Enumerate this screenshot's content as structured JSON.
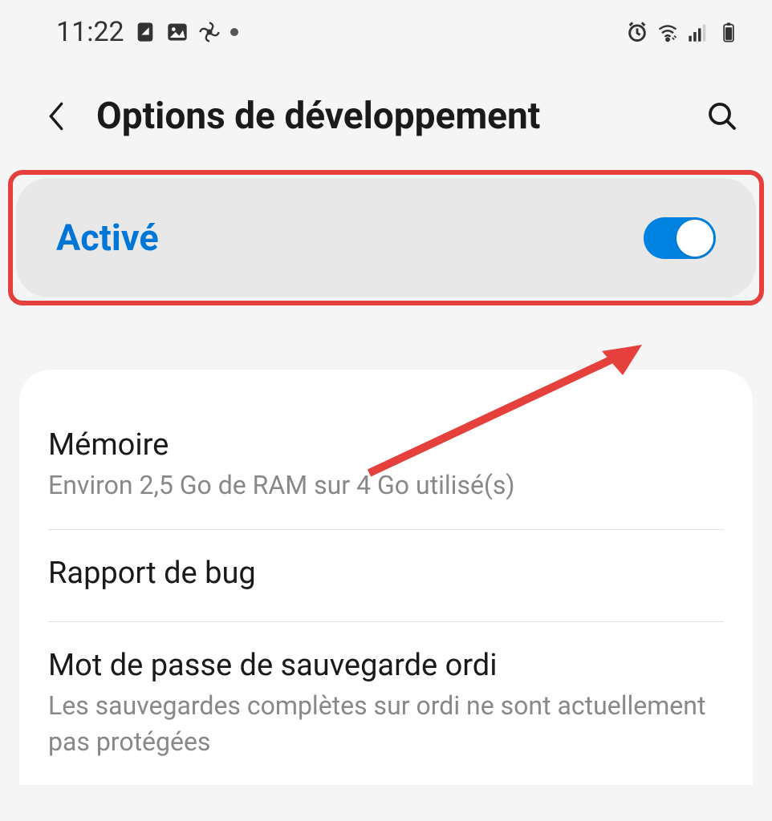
{
  "status_bar": {
    "time": "11:22"
  },
  "header": {
    "title": "Options de développement"
  },
  "toggle": {
    "label": "Activé",
    "state": "on"
  },
  "settings": [
    {
      "title": "Mémoire",
      "subtitle": "Environ 2,5 Go de RAM sur 4 Go utilisé(s)"
    },
    {
      "title": "Rapport de bug",
      "subtitle": ""
    },
    {
      "title": "Mot de passe de sauvegarde ordi",
      "subtitle": "Les sauvegardes complètes sur ordi ne sont actuellement pas protégées"
    }
  ]
}
